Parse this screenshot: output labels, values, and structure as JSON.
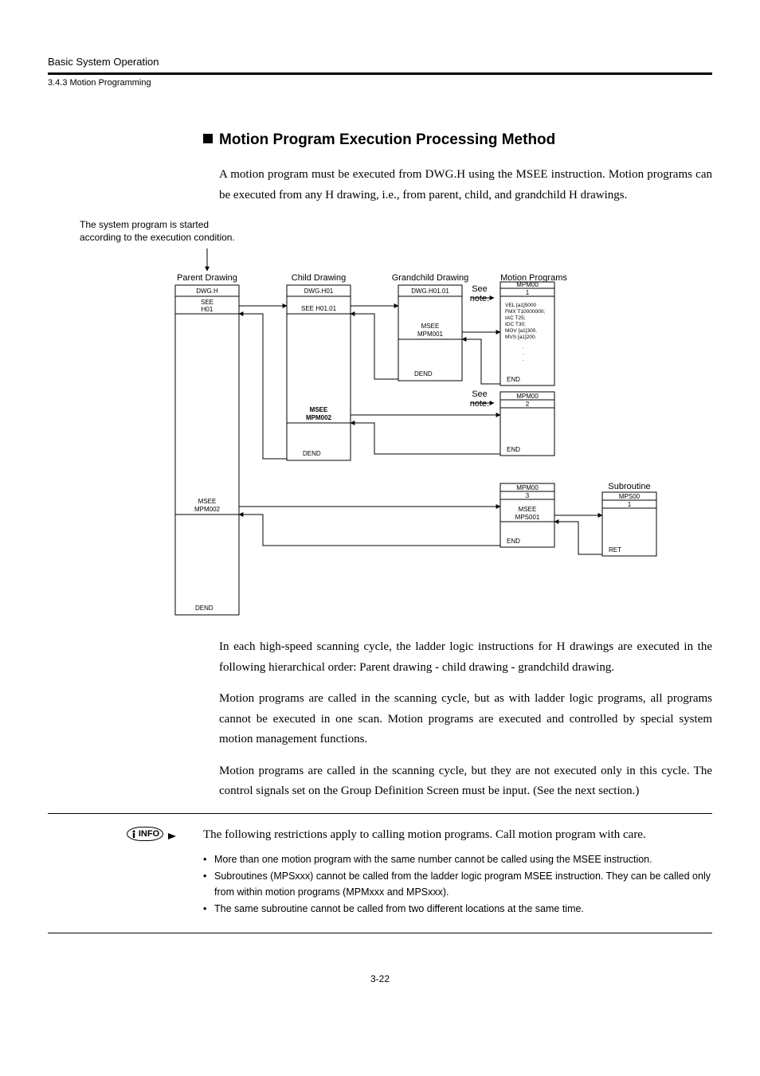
{
  "header": {
    "top": "Basic System Operation",
    "sub": "3.4.3  Motion Programming"
  },
  "heading": "Motion Program Execution Processing Method",
  "intro": "A motion program must be executed from DWG.H using the MSEE instruction. Motion programs can be executed from any H drawing, i.e., from parent, child, and grandchild H drawings.",
  "caption_line1": "The system program is started",
  "caption_line2": "according to the execution condition.",
  "diagram": {
    "col_parent": "Parent Drawing",
    "col_child": "Child Drawing",
    "col_gchild": "Grandchild Drawing",
    "col_motion": "Motion Programs",
    "col_sub": "Subroutine",
    "dwg_h": "DWG.H",
    "dwg_h01": "DWG.H01",
    "dwg_h0101": "DWG.H01.01",
    "see_h01": "SEE",
    "see_h01_b": "H01",
    "see_h0101": "SEE H01.01",
    "msee_mpm001": "MSEE",
    "msee_mpm001_b": "MPM001",
    "msee_mpm002a": "MSEE",
    "msee_mpm002a_b": "MPM002",
    "msee_mpm002b": "MSEE",
    "msee_mpm002b_b": "MPM002",
    "msee_mps001": "MSEE",
    "msee_mps001_b": "MPS001",
    "dend": "DEND",
    "end": "END",
    "ret": "RET",
    "see_note": "See",
    "see_note_b": "note.",
    "mpm00": "MPM00",
    "n1": "1",
    "n2": "2",
    "n3": "3",
    "mps00": "MPS00",
    "code1": "VEL [a1]5000",
    "code2": "FMX T10000000;",
    "code3": "IAC T25;",
    "code4": "IDC T30;",
    "code5": "MOV [a1]300.",
    "code6": "MVS [a1]200."
  },
  "body": {
    "p1": "In each high-speed scanning cycle, the ladder logic instructions for H drawings are executed in the following hierarchical order: Parent drawing - child drawing - grandchild drawing.",
    "p2": "Motion programs are called in the scanning cycle, but as with ladder logic programs, all programs cannot be executed in one scan. Motion programs are executed and controlled by special system motion management functions.",
    "p3": "Motion programs are called in the scanning cycle, but they are not executed only in this cycle. The control signals set on the Group Definition Screen must be input. (See the next section.)"
  },
  "info": {
    "badge": "INFO",
    "lead": "The following restrictions apply to calling motion programs. Call motion program with care.",
    "b1": "More than one motion program with the same number cannot be called using the MSEE instruction.",
    "b2": "Subroutines (MPSxxx) cannot be called from the ladder logic program MSEE instruction. They can be called only from within motion programs (MPMxxx and MPSxxx).",
    "b3": "The same subroutine cannot be called from two different locations at the same time."
  },
  "page_num": "3-22"
}
